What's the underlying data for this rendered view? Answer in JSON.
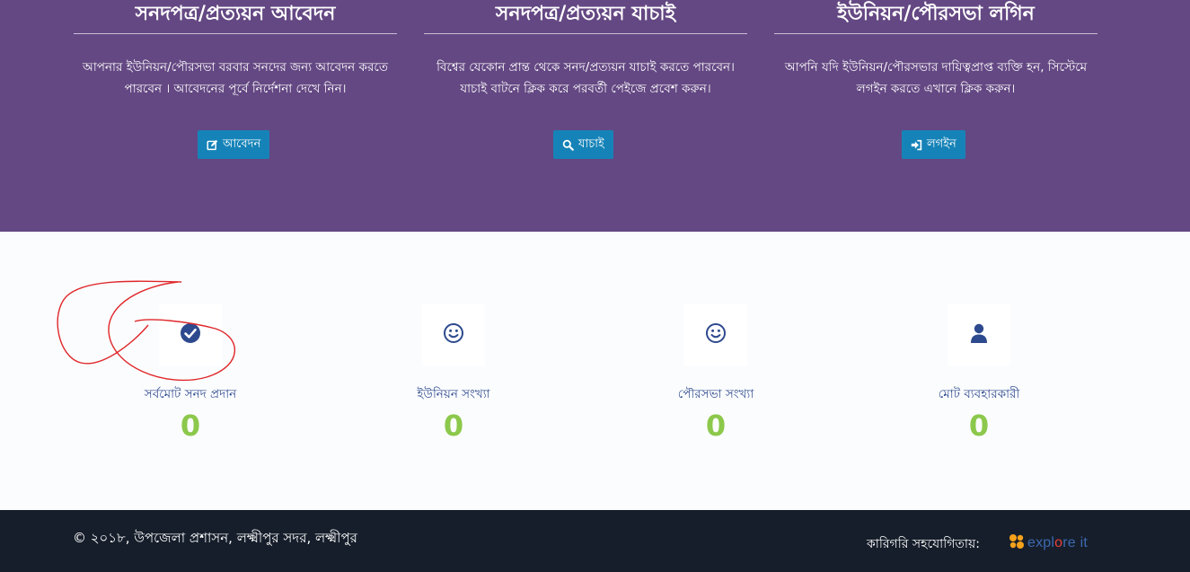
{
  "hero": {
    "columns": [
      {
        "title": "সনদপত্র/প্রত্যয়ন আবেদন",
        "description": "আপনার ইউনিয়ন/পৌরসভা বরবার সনদের জন্য আবেদন করতে পারবেন । আবেদনের পূর্বে নির্দেশনা দেখে নিন।",
        "button_label": "আবেদন",
        "button_icon": "edit-icon"
      },
      {
        "title": "সনদপত্র/প্রত্যয়ন যাচাই",
        "description": "বিশ্বের যেকোন প্রান্ত থেকে সনদ/প্রত্যয়ন যাচাই করতে পারবেন। যাচাই বাটনে ক্লিক করে পরবর্তী পেইজে প্রবেশ করুন।",
        "button_label": "যাচাই",
        "button_icon": "search-icon"
      },
      {
        "title": "ইউনিয়ন/পৌরসভা লগিন",
        "description": "আপনি যদি ইউনিয়ন/পৌরসভার দায়িত্বপ্রাপ্ত ব্যক্তি হন, সিস্টেমে লগইন করতে এখানে ক্লিক করুন।",
        "button_label": "লগইন",
        "button_icon": "sign-in-icon"
      }
    ]
  },
  "stats": [
    {
      "label": "সর্বমোট সনদ প্রদান",
      "value": "0",
      "icon": "check-circle-icon"
    },
    {
      "label": "ইউনিয়ন সংখ্যা",
      "value": "0",
      "icon": "smiley-icon"
    },
    {
      "label": "পৌরসভা সংখ্যা",
      "value": "0",
      "icon": "smiley-icon"
    },
    {
      "label": "মোট ব্যবহারকারী",
      "value": "0",
      "icon": "user-icon"
    }
  ],
  "footer": {
    "copyright": "© ২০১৮, উপজেলা প্রশাসন, লক্ষ্মীপুর সদর, লক্ষ্মীপুর",
    "tech_support_label": "কারিগরি সহযোগিতায়:",
    "brand_left": "expl",
    "brand_o": "o",
    "brand_right": "re",
    "brand_it": "it"
  },
  "colors": {
    "hero_bg": "#644883",
    "button_bg": "#1683b8",
    "stat_label": "#2e4a8e",
    "stat_value": "#8cc84b",
    "footer_bg": "#161e2b",
    "annotation_red": "#e0272a"
  }
}
